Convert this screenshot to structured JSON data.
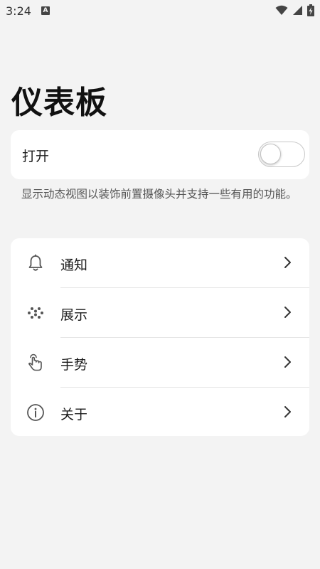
{
  "status_bar": {
    "time": "3:24",
    "notification_badge": "A",
    "icons": [
      "wifi-icon",
      "cellular-signal-icon",
      "battery-charging-icon"
    ]
  },
  "page": {
    "title": "仪表板"
  },
  "toggle": {
    "label": "打开",
    "state": "off"
  },
  "description": "显示动态视图以装饰前置摄像头并支持一些有用的功能。",
  "menu": {
    "items": [
      {
        "label": "通知",
        "icon": "bell-icon"
      },
      {
        "label": "展示",
        "icon": "dots-grid-icon"
      },
      {
        "label": "手势",
        "icon": "hand-pointer-icon"
      },
      {
        "label": "关于",
        "icon": "info-icon"
      }
    ]
  },
  "colors": {
    "background": "#f3f3f3",
    "card": "#ffffff",
    "text_primary": "#1c1c1c",
    "text_secondary": "#555555"
  }
}
